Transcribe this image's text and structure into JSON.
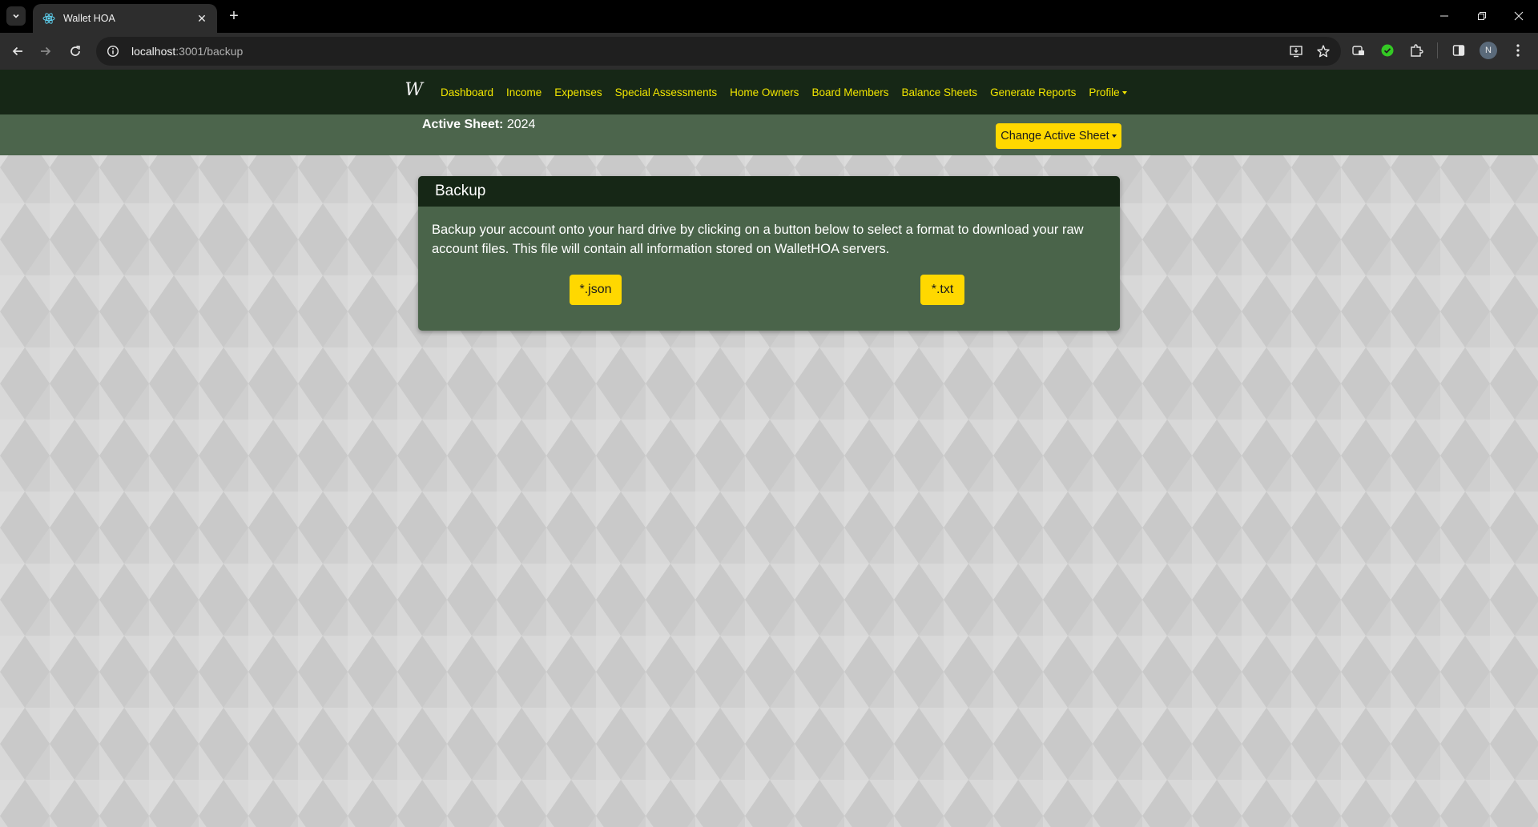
{
  "browser": {
    "tab_title": "Wallet HOA",
    "url_host": "localhost",
    "url_rest": ":3001/backup",
    "profile_initial": "N"
  },
  "nav": {
    "brand": "W",
    "links": [
      "Dashboard",
      "Income",
      "Expenses",
      "Special Assessments",
      "Home Owners",
      "Board Members",
      "Balance Sheets",
      "Generate Reports"
    ],
    "profile": "Profile"
  },
  "sheet": {
    "label": "Active Sheet:",
    "value": "2024",
    "change_button": "Change Active Sheet"
  },
  "card": {
    "title": "Backup",
    "description": "Backup your account onto your hard drive by clicking on a button below to select a format to download your raw account files. This file will contain all information stored on WalletHOA servers.",
    "buttons": [
      "*.json",
      "*.txt"
    ]
  },
  "colors": {
    "nav_bg": "#162716",
    "sheetbar_bg": "#4c654c",
    "card_bg": "#4a644a",
    "accent_yellow": "#ffd800",
    "nav_link": "#f2e600"
  }
}
